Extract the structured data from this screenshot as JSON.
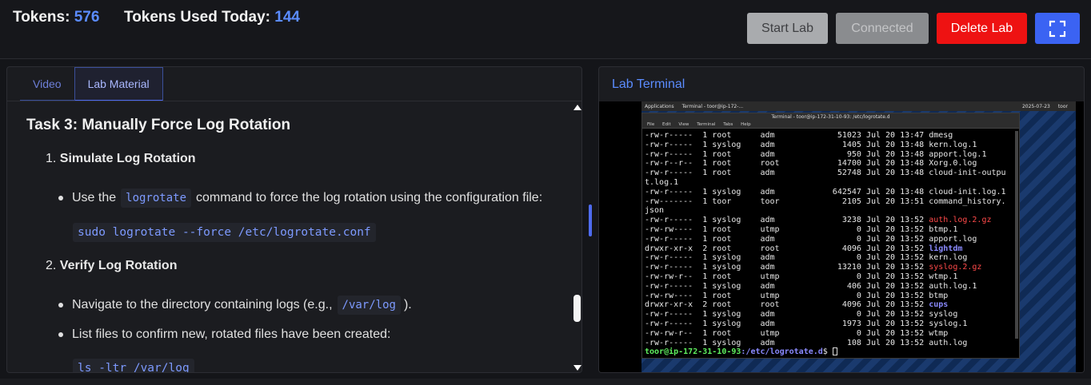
{
  "header": {
    "tokens_label": "Tokens:",
    "tokens_value": "576",
    "used_label": "Tokens Used Today:",
    "used_value": "144",
    "start_label": "Start Lab",
    "connected_label": "Connected",
    "delete_label": "Delete Lab",
    "fullscreen_icon": "fullscreen-icon"
  },
  "left_panel": {
    "tabs": [
      {
        "label": "Video"
      },
      {
        "label": "Lab Material"
      }
    ],
    "task_title": "Task 3: Manually Force Log Rotation",
    "step1": {
      "num": "1.",
      "title": "Simulate Log Rotation"
    },
    "step1_bullet": {
      "pre": "Use the",
      "code": "logrotate",
      "post": "command to force the log rotation using the configuration file:"
    },
    "step1_code": "sudo logrotate --force /etc/logrotate.conf",
    "step2": {
      "num": "2.",
      "title": "Verify Log Rotation"
    },
    "step2_bullet1": {
      "pre": "Navigate to the directory containing logs (e.g.,",
      "code": "/var/log",
      "post": ")."
    },
    "step2_bullet2": "List files to confirm new, rotated files have been created:",
    "step2_code": "ls -ltr /var/log"
  },
  "right_panel": {
    "title": "Lab Terminal",
    "taskbar": {
      "apps": "Applications",
      "terminal_task": "Terminal - toor@ip-172-...",
      "clock": "2025-07-23",
      "user": "toor"
    },
    "terminal": {
      "title": "Terminal - toor@ip-172-31-10-93: /etc/logrotate.d",
      "menu": [
        "File",
        "Edit",
        "View",
        "Terminal",
        "Tabs",
        "Help"
      ],
      "prompt_user": "toor@ip-172-31-10-93",
      "prompt_path": ":/etc/logrotate.d",
      "prompt_symbol": "$",
      "rows": [
        {
          "perm": "-rw-r-----",
          "n": "1",
          "owner": "root",
          "group": "adm",
          "size": "51023",
          "date": "Jul 20 13:47",
          "name": "dmesg",
          "color": ""
        },
        {
          "perm": "-rw-r-----",
          "n": "1",
          "owner": "syslog",
          "group": "adm",
          "size": "1405",
          "date": "Jul 20 13:48",
          "name": "kern.log.1",
          "color": ""
        },
        {
          "perm": "-rw-r-----",
          "n": "1",
          "owner": "root",
          "group": "adm",
          "size": "950",
          "date": "Jul 20 13:48",
          "name": "apport.log.1",
          "color": ""
        },
        {
          "perm": "-rw-r--r--",
          "n": "1",
          "owner": "root",
          "group": "root",
          "size": "14700",
          "date": "Jul 20 13:48",
          "name": "Xorg.0.log",
          "color": ""
        },
        {
          "perm": "-rw-r-----",
          "n": "1",
          "owner": "root",
          "group": "adm",
          "size": "52748",
          "date": "Jul 20 13:48",
          "name": "cloud-init-outpu",
          "color": ""
        },
        {
          "perm": "t.log.1",
          "n": "",
          "owner": "",
          "group": "",
          "size": "",
          "date": "",
          "name": "",
          "color": "wrap"
        },
        {
          "perm": "-rw-r-----",
          "n": "1",
          "owner": "syslog",
          "group": "adm",
          "size": "642547",
          "date": "Jul 20 13:48",
          "name": "cloud-init.log.1",
          "color": ""
        },
        {
          "perm": "-rw-------",
          "n": "1",
          "owner": "toor",
          "group": "toor",
          "size": "2105",
          "date": "Jul 20 13:51",
          "name": "command_history.",
          "color": ""
        },
        {
          "perm": "json",
          "n": "",
          "owner": "",
          "group": "",
          "size": "",
          "date": "",
          "name": "",
          "color": "wrap"
        },
        {
          "perm": "-rw-r-----",
          "n": "1",
          "owner": "syslog",
          "group": "adm",
          "size": "3238",
          "date": "Jul 20 13:52",
          "name": "auth.log.2.gz",
          "color": "red"
        },
        {
          "perm": "-rw-rw----",
          "n": "1",
          "owner": "root",
          "group": "utmp",
          "size": "0",
          "date": "Jul 20 13:52",
          "name": "btmp.1",
          "color": ""
        },
        {
          "perm": "-rw-r-----",
          "n": "1",
          "owner": "root",
          "group": "adm",
          "size": "0",
          "date": "Jul 20 13:52",
          "name": "apport.log",
          "color": ""
        },
        {
          "perm": "drwxr-xr-x",
          "n": "2",
          "owner": "root",
          "group": "root",
          "size": "4096",
          "date": "Jul 20 13:52",
          "name": "lightdm",
          "color": "blue"
        },
        {
          "perm": "-rw-r-----",
          "n": "1",
          "owner": "syslog",
          "group": "adm",
          "size": "0",
          "date": "Jul 20 13:52",
          "name": "kern.log",
          "color": ""
        },
        {
          "perm": "-rw-r-----",
          "n": "1",
          "owner": "syslog",
          "group": "adm",
          "size": "13210",
          "date": "Jul 20 13:52",
          "name": "syslog.2.gz",
          "color": "red"
        },
        {
          "perm": "-rw-rw-r--",
          "n": "1",
          "owner": "root",
          "group": "utmp",
          "size": "0",
          "date": "Jul 20 13:52",
          "name": "wtmp.1",
          "color": ""
        },
        {
          "perm": "-rw-r-----",
          "n": "1",
          "owner": "syslog",
          "group": "adm",
          "size": "406",
          "date": "Jul 20 13:52",
          "name": "auth.log.1",
          "color": ""
        },
        {
          "perm": "-rw-rw----",
          "n": "1",
          "owner": "root",
          "group": "utmp",
          "size": "0",
          "date": "Jul 20 13:52",
          "name": "btmp",
          "color": ""
        },
        {
          "perm": "drwxr-xr-x",
          "n": "2",
          "owner": "root",
          "group": "root",
          "size": "4096",
          "date": "Jul 20 13:52",
          "name": "cups",
          "color": "blue"
        },
        {
          "perm": "-rw-r-----",
          "n": "1",
          "owner": "syslog",
          "group": "adm",
          "size": "0",
          "date": "Jul 20 13:52",
          "name": "syslog",
          "color": ""
        },
        {
          "perm": "-rw-r-----",
          "n": "1",
          "owner": "syslog",
          "group": "adm",
          "size": "1973",
          "date": "Jul 20 13:52",
          "name": "syslog.1",
          "color": ""
        },
        {
          "perm": "-rw-rw-r--",
          "n": "1",
          "owner": "root",
          "group": "utmp",
          "size": "0",
          "date": "Jul 20 13:52",
          "name": "wtmp",
          "color": ""
        },
        {
          "perm": "-rw-r-----",
          "n": "1",
          "owner": "syslog",
          "group": "adm",
          "size": "108",
          "date": "Jul 20 13:52",
          "name": "auth.log",
          "color": ""
        }
      ]
    }
  },
  "colors": {
    "accent": "#5b8cff",
    "delete": "#ee1212",
    "fullscreen": "#3b63f3"
  }
}
